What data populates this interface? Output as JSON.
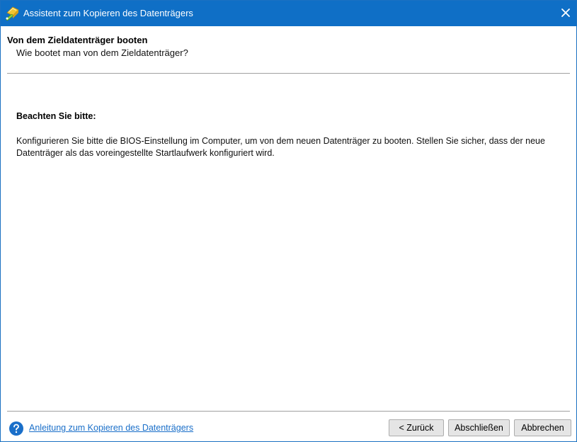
{
  "window": {
    "title": "Assistent zum Kopieren des Datenträgers",
    "icon": "wizard-wand-icon",
    "close_icon": "close-icon"
  },
  "header": {
    "title": "Von dem Zieldatenträger booten",
    "subtitle": "Wie bootet man von dem Zieldatenträger?"
  },
  "content": {
    "note_title": "Beachten Sie bitte:",
    "note_text": "Konfigurieren Sie bitte die BIOS-Einstellung im Computer, um von dem neuen Datenträger zu booten. Stellen Sie sicher, dass der neue Datenträger als das voreingestellte Startlaufwerk konfiguriert wird."
  },
  "footer": {
    "help_icon": "help-icon",
    "help_link": "Anleitung zum Kopieren des Datenträgers",
    "back_label": "< Zurück",
    "finish_label": "Abschließen",
    "cancel_label": "Abbrechen"
  },
  "colors": {
    "titlebar": "#0f6fc6",
    "link": "#1a6fc9",
    "button_bg": "#e5e5e5"
  }
}
